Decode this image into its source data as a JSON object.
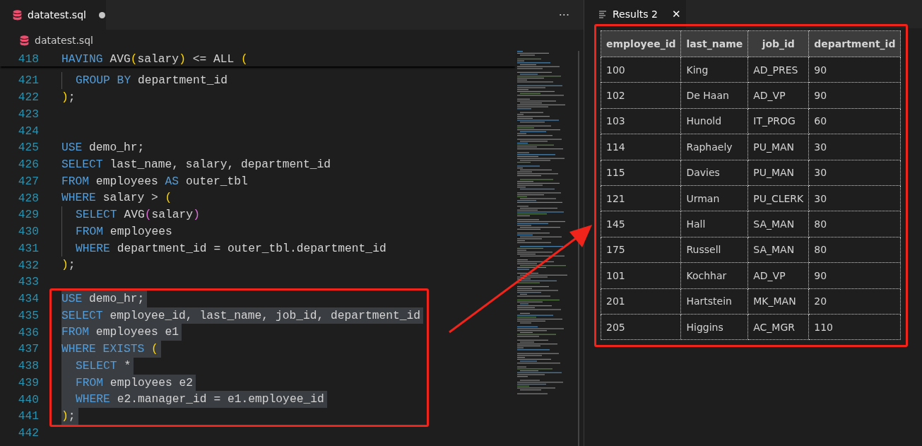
{
  "editor": {
    "tab": {
      "title": "datatest.sql",
      "modified": true
    },
    "more_button": "···",
    "breadcrumb": "datatest.sql",
    "sticky_line": {
      "number": "418",
      "tokens": [
        {
          "kind": "keyword",
          "text": "HAVING"
        },
        {
          "kind": "text",
          "text": " AVG"
        },
        {
          "kind": "paren",
          "text": "("
        },
        {
          "kind": "text",
          "text": "salary"
        },
        {
          "kind": "paren",
          "text": ")"
        },
        {
          "kind": "text",
          "text": " <= ALL "
        },
        {
          "kind": "paren",
          "text": "("
        }
      ]
    },
    "lines": [
      {
        "number": "421",
        "indented": true,
        "selected": false,
        "tokens": [
          {
            "kind": "keyword",
            "text": "GROUP BY"
          },
          {
            "kind": "text",
            "text": " department_id"
          }
        ]
      },
      {
        "number": "422",
        "indented": false,
        "selected": false,
        "tokens": [
          {
            "kind": "paren",
            "text": ")"
          },
          {
            "kind": "text",
            "text": ";"
          }
        ]
      },
      {
        "number": "423"
      },
      {
        "number": "424"
      },
      {
        "number": "425",
        "indented": false,
        "selected": false,
        "tokens": [
          {
            "kind": "keyword",
            "text": "USE"
          },
          {
            "kind": "text",
            "text": " demo_hr;"
          }
        ]
      },
      {
        "number": "426",
        "indented": false,
        "selected": false,
        "tokens": [
          {
            "kind": "keyword",
            "text": "SELECT"
          },
          {
            "kind": "text",
            "text": " last_name, salary, department_id"
          }
        ]
      },
      {
        "number": "427",
        "indented": false,
        "selected": false,
        "tokens": [
          {
            "kind": "keyword",
            "text": "FROM"
          },
          {
            "kind": "text",
            "text": " employees "
          },
          {
            "kind": "keyword",
            "text": "AS"
          },
          {
            "kind": "text",
            "text": " outer_tbl"
          }
        ]
      },
      {
        "number": "428",
        "indented": false,
        "selected": false,
        "tokens": [
          {
            "kind": "keyword",
            "text": "WHERE"
          },
          {
            "kind": "text",
            "text": " salary > "
          },
          {
            "kind": "paren",
            "text": "("
          }
        ]
      },
      {
        "number": "429",
        "indented": true,
        "selected": false,
        "tokens": [
          {
            "kind": "keyword",
            "text": "SELECT"
          },
          {
            "kind": "text",
            "text": " AVG"
          },
          {
            "kind": "paren2",
            "text": "("
          },
          {
            "kind": "text",
            "text": "salary"
          },
          {
            "kind": "paren2",
            "text": ")"
          }
        ]
      },
      {
        "number": "430",
        "indented": true,
        "selected": false,
        "tokens": [
          {
            "kind": "keyword",
            "text": "FROM"
          },
          {
            "kind": "text",
            "text": " employees"
          }
        ]
      },
      {
        "number": "431",
        "indented": true,
        "selected": false,
        "tokens": [
          {
            "kind": "keyword",
            "text": "WHERE"
          },
          {
            "kind": "text",
            "text": " department_id = outer_tbl.department_id"
          }
        ]
      },
      {
        "number": "432",
        "indented": false,
        "selected": false,
        "tokens": [
          {
            "kind": "paren",
            "text": ")"
          },
          {
            "kind": "text",
            "text": ";"
          }
        ]
      },
      {
        "number": "433"
      },
      {
        "number": "434",
        "indented": false,
        "selected": true,
        "tokens": [
          {
            "kind": "keyword",
            "text": "USE"
          },
          {
            "kind": "text",
            "text": " demo_hr;"
          }
        ]
      },
      {
        "number": "435",
        "indented": false,
        "selected": true,
        "tokens": [
          {
            "kind": "keyword",
            "text": "SELECT"
          },
          {
            "kind": "text",
            "text": " employee_id, last_name, job_id, department_id"
          }
        ]
      },
      {
        "number": "436",
        "indented": false,
        "selected": true,
        "tokens": [
          {
            "kind": "keyword",
            "text": "FROM"
          },
          {
            "kind": "text",
            "text": " employees e1"
          }
        ]
      },
      {
        "number": "437",
        "indented": false,
        "selected": true,
        "tokens": [
          {
            "kind": "keyword",
            "text": "WHERE EXISTS"
          },
          {
            "kind": "paren",
            "text": " ("
          }
        ]
      },
      {
        "number": "438",
        "indented": true,
        "selected": true,
        "tokens": [
          {
            "kind": "keyword",
            "text": "SELECT"
          },
          {
            "kind": "text",
            "text": " *"
          }
        ]
      },
      {
        "number": "439",
        "indented": true,
        "selected": true,
        "tokens": [
          {
            "kind": "keyword",
            "text": "FROM"
          },
          {
            "kind": "text",
            "text": " employees e2"
          }
        ]
      },
      {
        "number": "440",
        "indented": true,
        "selected": true,
        "tokens": [
          {
            "kind": "keyword",
            "text": "WHERE"
          },
          {
            "kind": "text",
            "text": " e2.manager_id = e1.employee_id"
          }
        ]
      },
      {
        "number": "441",
        "indented": false,
        "selected": true,
        "tokens": [
          {
            "kind": "paren",
            "text": ")"
          },
          {
            "kind": "text",
            "text": ";"
          }
        ]
      },
      {
        "number": "442"
      }
    ]
  },
  "results": {
    "tab": {
      "title": "Results 2",
      "close": "✕"
    },
    "columns": [
      "employee_id",
      "last_name",
      "job_id",
      "department_id"
    ],
    "rows": [
      [
        "100",
        "King",
        "AD_PRES",
        "90"
      ],
      [
        "102",
        "De Haan",
        "AD_VP",
        "90"
      ],
      [
        "103",
        "Hunold",
        "IT_PROG",
        "60"
      ],
      [
        "114",
        "Raphaely",
        "PU_MAN",
        "30"
      ],
      [
        "115",
        "Davies",
        "PU_MAN",
        "30"
      ],
      [
        "121",
        "Urman",
        "PU_CLERK",
        "30"
      ],
      [
        "145",
        "Hall",
        "SA_MAN",
        "80"
      ],
      [
        "175",
        "Russell",
        "SA_MAN",
        "80"
      ],
      [
        "101",
        "Kochhar",
        "AD_VP",
        "90"
      ],
      [
        "201",
        "Hartstein",
        "MK_MAN",
        "20"
      ],
      [
        "205",
        "Higgins",
        "AC_MGR",
        "110"
      ]
    ]
  },
  "annotation": {
    "code_frame": true,
    "results_frame": true,
    "arrow": true
  }
}
